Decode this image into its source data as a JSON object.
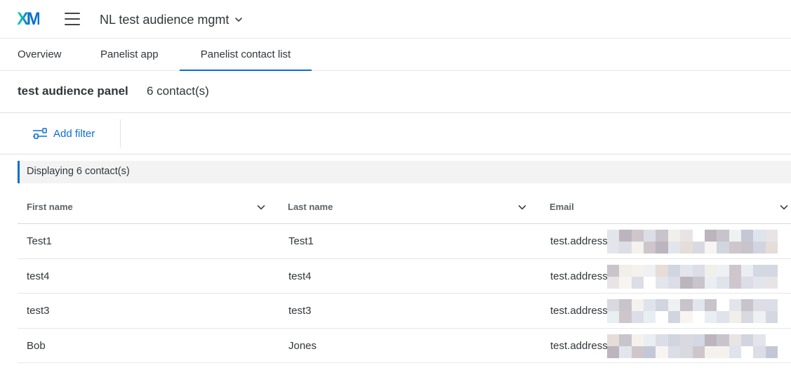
{
  "app": {
    "logo_text": "XM",
    "project_name": "NL test audience mgmt"
  },
  "tabs": [
    {
      "label": "Overview",
      "active": false
    },
    {
      "label": "Panelist app",
      "active": false
    },
    {
      "label": "Panelist contact list",
      "active": true
    }
  ],
  "panel": {
    "title": "test audience panel",
    "count": "6 contact(s)"
  },
  "filter": {
    "add_filter_label": "Add filter"
  },
  "display": {
    "text": "Displaying 6 contact(s)"
  },
  "table": {
    "columns": [
      "First name",
      "Last name",
      "Email"
    ],
    "rows": [
      {
        "first": "Test1",
        "last": "Test1",
        "email": "test.address"
      },
      {
        "first": "test4",
        "last": "test4",
        "email": "test.address"
      },
      {
        "first": "test3",
        "last": "test3",
        "email": "test.address"
      },
      {
        "first": "Bob",
        "last": "Jones",
        "email": "test.address"
      }
    ]
  },
  "colors": {
    "accent": "#0b6ed0",
    "logo_green": "#21dbaa",
    "text": "#32363a",
    "header_text": "#5f6367",
    "display_bar_bg": "#f3f3f4"
  },
  "icons": {
    "menu": "hamburger-icon",
    "project_dropdown": "chevron-down-icon",
    "filter": "filter-sliders-icon",
    "column_sort": "chevron-down-icon"
  }
}
